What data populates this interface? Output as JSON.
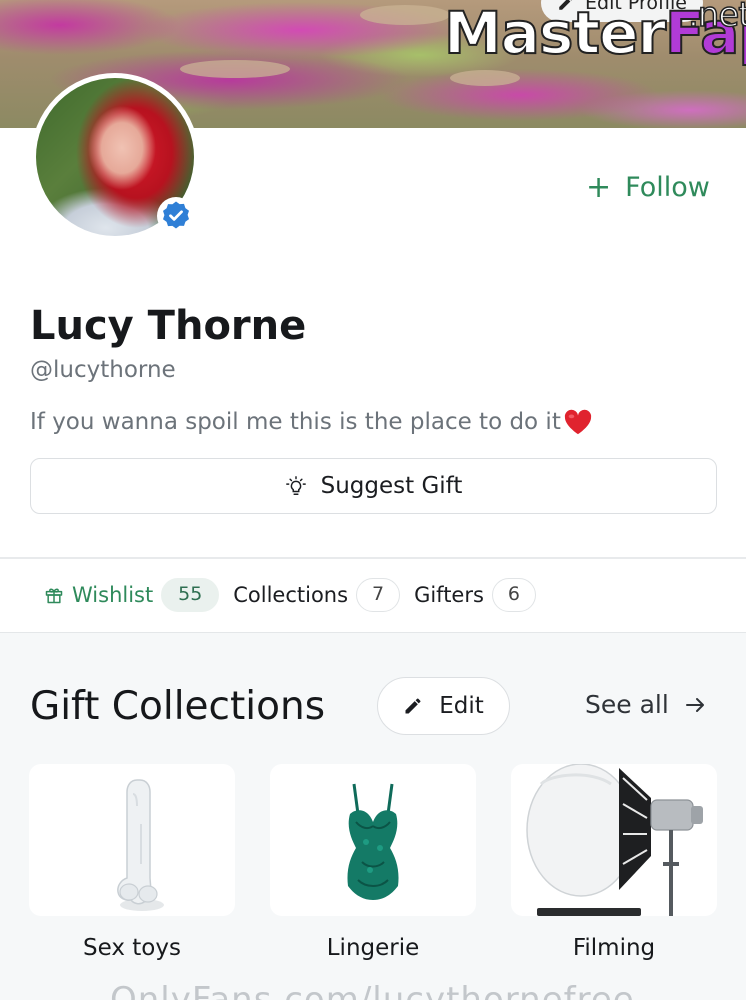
{
  "header": {
    "edit_profile_label": "Edit Profile",
    "watermark": {
      "main": "Master",
      "accent": "Fap",
      "tld": ".net"
    }
  },
  "profile": {
    "name": "Lucy Thorne",
    "handle": "@lucythorne",
    "bio": "If you wanna spoil me this is the place to do it",
    "verified": true,
    "follow_label": "Follow",
    "follow_icon": "plus-icon"
  },
  "suggest_gift": {
    "label": "Suggest Gift",
    "icon": "lightbulb-icon"
  },
  "tabs": [
    {
      "label": "Wishlist",
      "count": "55",
      "active": true,
      "icon": "gift-icon"
    },
    {
      "label": "Collections",
      "count": "7",
      "active": false
    },
    {
      "label": "Gifters",
      "count": "6",
      "active": false
    }
  ],
  "gift_collections": {
    "title": "Gift Collections",
    "edit_label": "Edit",
    "see_all_label": "See all",
    "items": [
      {
        "label": "Sex toys"
      },
      {
        "label": "Lingerie"
      },
      {
        "label": "Filming"
      }
    ]
  },
  "overlay_text": "OnlyFans.com/lucythornefree",
  "colors": {
    "accent_green": "#2f8a5b",
    "verified_blue": "#2f7fd6",
    "watermark_accent": "#b13bd6"
  }
}
